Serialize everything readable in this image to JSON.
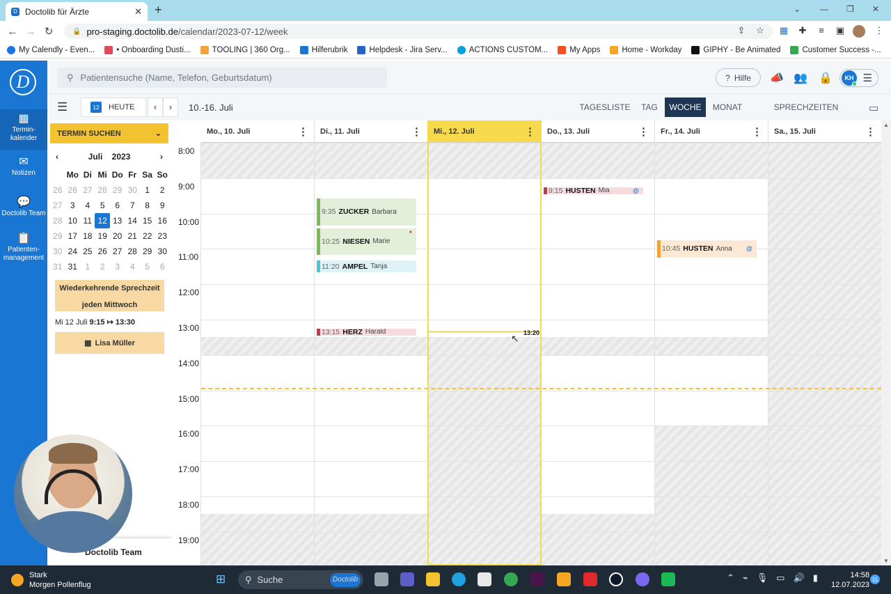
{
  "browser": {
    "tab_title": "Doctolib für Ärzte",
    "url_host": "pro-staging.doctolib.de",
    "url_path": "/calendar/2023-07-12/week",
    "bookmarks": [
      {
        "label": "My Calendly - Even...",
        "color": "#1a73e8"
      },
      {
        "label": "• Onboarding Dusti...",
        "color": "#e24a5a"
      },
      {
        "label": "TOOLING | 360 Org...",
        "color": "#f2a33a"
      },
      {
        "label": "Hilferubrik",
        "color": "#1976d2"
      },
      {
        "label": "Helpdesk - Jira Serv...",
        "color": "#2563c9"
      },
      {
        "label": "ACTIONS CUSTOM...",
        "color": "#00a1e0"
      },
      {
        "label": "My Apps",
        "color": "#f25022"
      },
      {
        "label": "Home - Workday",
        "color": "#f5a623"
      },
      {
        "label": "GIPHY - Be Animated",
        "color": "#111111"
      },
      {
        "label": "Customer Success -...",
        "color": "#34a853"
      }
    ]
  },
  "rail": {
    "items": [
      {
        "label": "Termin-\nkalender",
        "icon": "calendar-icon"
      },
      {
        "label": "Notizen",
        "icon": "mail-icon"
      },
      {
        "label": "Doctolib Team",
        "icon": "chat-icon"
      },
      {
        "label": "Patienten-\nmanagement",
        "icon": "clipboard-icon"
      }
    ]
  },
  "topbar": {
    "search_placeholder": "Patientensuche (Name, Telefon, Geburtsdatum)",
    "help_label": "Hilfe",
    "avatar_initials": "KH"
  },
  "toolbar": {
    "today_icon_day": "12",
    "today_label": "HEUTE",
    "range_label": "10.-16. Juli",
    "views": [
      "TAGESLISTE",
      "TAG",
      "WOCHE",
      "MONAT",
      "SPRECHZEITEN ÄNDERN"
    ],
    "active_view": "WOCHE"
  },
  "left": {
    "termin_suchen": "TERMIN SUCHEN",
    "mini_month": "Juli",
    "mini_year": "2023",
    "weekday_headers": [
      "Mo",
      "Di",
      "Mi",
      "Do",
      "Fr",
      "Sa",
      "So"
    ],
    "weeks": [
      {
        "wk": "26",
        "days": [
          "26",
          "27",
          "28",
          "29",
          "30",
          "1",
          "2"
        ]
      },
      {
        "wk": "27",
        "days": [
          "3",
          "4",
          "5",
          "6",
          "7",
          "8",
          "9"
        ]
      },
      {
        "wk": "28",
        "days": [
          "10",
          "11",
          "12",
          "13",
          "14",
          "15",
          "16"
        ]
      },
      {
        "wk": "29",
        "days": [
          "17",
          "18",
          "19",
          "20",
          "21",
          "22",
          "23"
        ]
      },
      {
        "wk": "30",
        "days": [
          "24",
          "25",
          "26",
          "27",
          "28",
          "29",
          "30"
        ]
      },
      {
        "wk": "31",
        "days": [
          "31",
          "1",
          "2",
          "3",
          "4",
          "5",
          "6"
        ]
      }
    ],
    "recurring_line1": "Wiederkehrende Sprechzeit",
    "recurring_line2": "jeden Mittwoch",
    "sprech_date": "Mi 12 Juli",
    "sprech_time": "9:15 ↦ 13:30",
    "practitioner": "Lisa Müller",
    "team_label": "Doctolib Team"
  },
  "calendar": {
    "days": [
      {
        "label": "Mo., 10. Juli"
      },
      {
        "label": "Di., 11. Juli"
      },
      {
        "label": "Mi., 12. Juli",
        "today": true
      },
      {
        "label": "Do., 13. Juli"
      },
      {
        "label": "Fr., 14. Juli"
      },
      {
        "label": "Sa., 15. Juli"
      }
    ],
    "hours": [
      "8:00",
      "9:00",
      "10:00",
      "11:00",
      "12:00",
      "13:00",
      "14:00",
      "15:00",
      "16:00",
      "17:00",
      "18:00",
      "19:00"
    ],
    "now_label": "13:20",
    "appointments": [
      {
        "day": 1,
        "start": "9:35",
        "end": "10:20",
        "last": "ZUCKER",
        "first": "Barbara",
        "bg": "#e3efd9",
        "bar": "#7dbb54"
      },
      {
        "day": 1,
        "start": "10:25",
        "end": "11:10",
        "last": "NIESEN",
        "first": "Marie",
        "bg": "#e3efd9",
        "bar": "#7dbb54"
      },
      {
        "day": 1,
        "start": "11:20",
        "end": "11:40",
        "last": "AMPEL",
        "first": "Tanja",
        "bg": "#dff3f6",
        "bar": "#4ec6d6"
      },
      {
        "day": 1,
        "start": "13:15",
        "end": "13:27",
        "last": "HERZ",
        "first": "Harald",
        "bg": "#f6dcdf",
        "bar": "#c43a45"
      },
      {
        "day": 3,
        "start": "9:15",
        "end": "9:27",
        "last": "HUSTEN",
        "first": "Mia",
        "bg": "#f6dcdf",
        "bar": "#c43a45"
      },
      {
        "day": 4,
        "start": "10:45",
        "end": "11:15",
        "last": "HUSTEN",
        "first": "Anna",
        "bg": "#fbe9d6",
        "bar": "#f2a33a"
      }
    ]
  },
  "taskbar": {
    "weather_title": "Stark",
    "weather_sub": "Morgen Pollenflug",
    "search_label": "Suche",
    "search_badge": "Doctolib",
    "time": "14:58",
    "date": "12.07.2023",
    "notifications": "11"
  },
  "colors": {
    "brand_blue": "#1976d2",
    "today_yellow": "#f7d94c",
    "button_yellow": "#f2c230"
  }
}
